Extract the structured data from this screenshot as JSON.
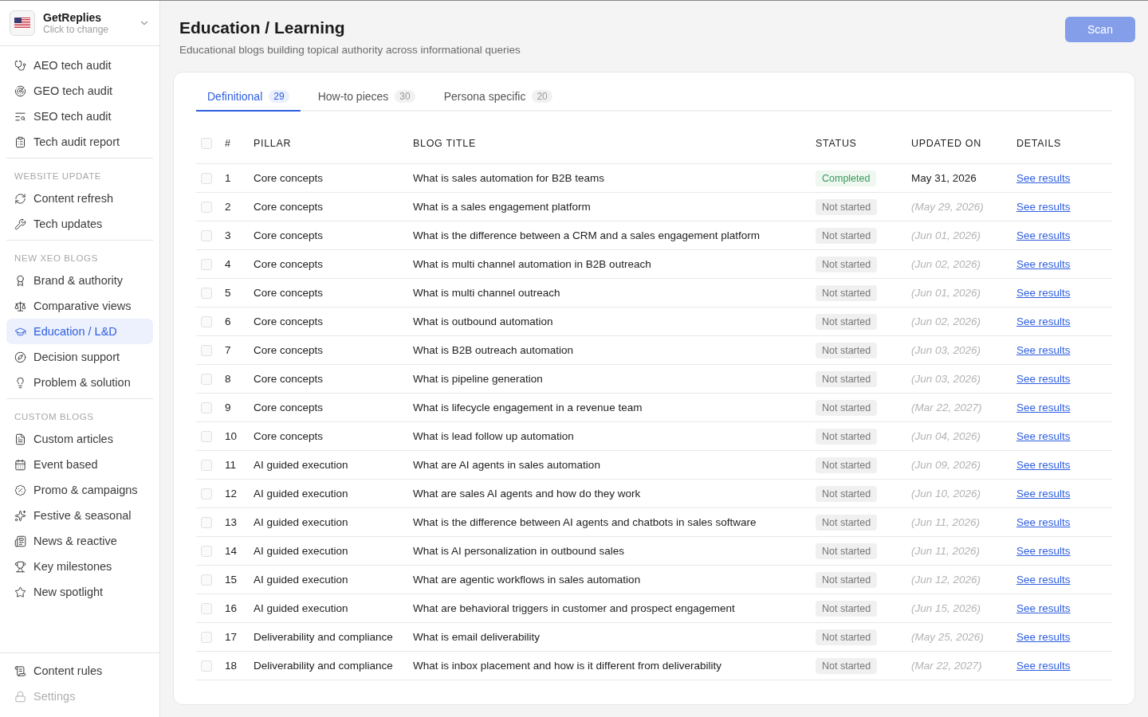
{
  "brand": {
    "name": "GetReplies",
    "hint": "Click to change"
  },
  "sidebar": {
    "sections": [
      {
        "items": [
          {
            "label": "AEO tech audit",
            "selected": false,
            "disabled": false
          },
          {
            "label": "GEO tech audit",
            "selected": false,
            "disabled": false
          },
          {
            "label": "SEO tech audit",
            "selected": false,
            "disabled": false
          },
          {
            "label": "Tech audit report",
            "selected": false,
            "disabled": false
          }
        ]
      },
      {
        "heading": "WEBSITE UPDATE",
        "items": [
          {
            "label": "Content refresh",
            "selected": false,
            "disabled": false
          },
          {
            "label": "Tech updates",
            "selected": false,
            "disabled": false
          }
        ]
      },
      {
        "heading": "NEW XEO BLOGS",
        "items": [
          {
            "label": "Brand & authority",
            "selected": false,
            "disabled": false
          },
          {
            "label": "Comparative views",
            "selected": false,
            "disabled": false
          },
          {
            "label": "Education / L&D",
            "selected": true,
            "disabled": false
          },
          {
            "label": "Decision support",
            "selected": false,
            "disabled": false
          },
          {
            "label": "Problem & solution",
            "selected": false,
            "disabled": false
          }
        ]
      },
      {
        "heading": "CUSTOM BLOGS",
        "items": [
          {
            "label": "Custom articles",
            "selected": false,
            "disabled": false
          },
          {
            "label": "Event based",
            "selected": false,
            "disabled": false
          },
          {
            "label": "Promo & campaigns",
            "selected": false,
            "disabled": false
          },
          {
            "label": "Festive & seasonal",
            "selected": false,
            "disabled": false
          },
          {
            "label": "News & reactive",
            "selected": false,
            "disabled": false
          },
          {
            "label": "Key milestones",
            "selected": false,
            "disabled": false
          },
          {
            "label": "New spotlight",
            "selected": false,
            "disabled": false
          }
        ]
      },
      {
        "items": [
          {
            "label": "Content rules",
            "selected": false,
            "disabled": false
          },
          {
            "label": "Settings",
            "selected": false,
            "disabled": true
          }
        ]
      }
    ]
  },
  "page": {
    "title": "Education / Learning",
    "subtitle": "Educational blogs building topical authority across informational queries",
    "scan_button": {
      "label": "Scan",
      "disabled": true
    }
  },
  "tabs": [
    {
      "label": "Definitional",
      "count": "29",
      "selected": true
    },
    {
      "label": "How-to pieces",
      "count": "30",
      "selected": false
    },
    {
      "label": "Persona specific",
      "count": "20",
      "selected": false
    }
  ],
  "table": {
    "header_checked": false,
    "columns": [
      "#",
      "PILLAR",
      "BLOG TITLE",
      "STATUS",
      "UPDATED ON",
      "DETAILS"
    ],
    "rows": [
      {
        "checked": false,
        "number": "1",
        "pillar": "Core concepts",
        "title": "What is sales automation for B2B teams",
        "status": {
          "label": "Completed",
          "kind": "completed"
        },
        "updated": {
          "text": "May 31, 2026",
          "estimated": false
        },
        "details": "See results"
      },
      {
        "checked": false,
        "number": "2",
        "pillar": "Core concepts",
        "title": "What is a sales engagement platform",
        "status": {
          "label": "Not started",
          "kind": "not_started"
        },
        "updated": {
          "text": "(May 29, 2026)",
          "estimated": true
        },
        "details": "See results"
      },
      {
        "checked": false,
        "number": "3",
        "pillar": "Core concepts",
        "title": "What is the difference between a CRM and a sales engagement platform",
        "status": {
          "label": "Not started",
          "kind": "not_started"
        },
        "updated": {
          "text": "(Jun 01, 2026)",
          "estimated": true
        },
        "details": "See results"
      },
      {
        "checked": false,
        "number": "4",
        "pillar": "Core concepts",
        "title": "What is multi channel automation in B2B outreach",
        "status": {
          "label": "Not started",
          "kind": "not_started"
        },
        "updated": {
          "text": "(Jun 02, 2026)",
          "estimated": true
        },
        "details": "See results"
      },
      {
        "checked": false,
        "number": "5",
        "pillar": "Core concepts",
        "title": "What is multi channel outreach",
        "status": {
          "label": "Not started",
          "kind": "not_started"
        },
        "updated": {
          "text": "(Jun 01, 2026)",
          "estimated": true
        },
        "details": "See results"
      },
      {
        "checked": false,
        "number": "6",
        "pillar": "Core concepts",
        "title": "What is outbound automation",
        "status": {
          "label": "Not started",
          "kind": "not_started"
        },
        "updated": {
          "text": "(Jun 02, 2026)",
          "estimated": true
        },
        "details": "See results"
      },
      {
        "checked": false,
        "number": "7",
        "pillar": "Core concepts",
        "title": "What is B2B outreach automation",
        "status": {
          "label": "Not started",
          "kind": "not_started"
        },
        "updated": {
          "text": "(Jun 03, 2026)",
          "estimated": true
        },
        "details": "See results"
      },
      {
        "checked": false,
        "number": "8",
        "pillar": "Core concepts",
        "title": "What is pipeline generation",
        "status": {
          "label": "Not started",
          "kind": "not_started"
        },
        "updated": {
          "text": "(Jun 03, 2026)",
          "estimated": true
        },
        "details": "See results"
      },
      {
        "checked": false,
        "number": "9",
        "pillar": "Core concepts",
        "title": "What is lifecycle engagement in a revenue team",
        "status": {
          "label": "Not started",
          "kind": "not_started"
        },
        "updated": {
          "text": "(Mar 22, 2027)",
          "estimated": true
        },
        "details": "See results"
      },
      {
        "checked": false,
        "number": "10",
        "pillar": "Core concepts",
        "title": "What is lead follow up automation",
        "status": {
          "label": "Not started",
          "kind": "not_started"
        },
        "updated": {
          "text": "(Jun 04, 2026)",
          "estimated": true
        },
        "details": "See results"
      },
      {
        "checked": false,
        "number": "11",
        "pillar": "AI guided execution",
        "title": "What are AI agents in sales automation",
        "status": {
          "label": "Not started",
          "kind": "not_started"
        },
        "updated": {
          "text": "(Jun 09, 2026)",
          "estimated": true
        },
        "details": "See results"
      },
      {
        "checked": false,
        "number": "12",
        "pillar": "AI guided execution",
        "title": "What are sales AI agents and how do they work",
        "status": {
          "label": "Not started",
          "kind": "not_started"
        },
        "updated": {
          "text": "(Jun 10, 2026)",
          "estimated": true
        },
        "details": "See results"
      },
      {
        "checked": false,
        "number": "13",
        "pillar": "AI guided execution",
        "title": "What is the difference between AI agents and chatbots in sales software",
        "status": {
          "label": "Not started",
          "kind": "not_started"
        },
        "updated": {
          "text": "(Jun 11, 2026)",
          "estimated": true
        },
        "details": "See results"
      },
      {
        "checked": false,
        "number": "14",
        "pillar": "AI guided execution",
        "title": "What is AI personalization in outbound sales",
        "status": {
          "label": "Not started",
          "kind": "not_started"
        },
        "updated": {
          "text": "(Jun 11, 2026)",
          "estimated": true
        },
        "details": "See results"
      },
      {
        "checked": false,
        "number": "15",
        "pillar": "AI guided execution",
        "title": "What are agentic workflows in sales automation",
        "status": {
          "label": "Not started",
          "kind": "not_started"
        },
        "updated": {
          "text": "(Jun 12, 2026)",
          "estimated": true
        },
        "details": "See results"
      },
      {
        "checked": false,
        "number": "16",
        "pillar": "AI guided execution",
        "title": "What are behavioral triggers in customer and prospect engagement",
        "status": {
          "label": "Not started",
          "kind": "not_started"
        },
        "updated": {
          "text": "(Jun 15, 2026)",
          "estimated": true
        },
        "details": "See results"
      },
      {
        "checked": false,
        "number": "17",
        "pillar": "Deliverability and compliance",
        "title": "What is email deliverability",
        "status": {
          "label": "Not started",
          "kind": "not_started"
        },
        "updated": {
          "text": "(May 25, 2026)",
          "estimated": true
        },
        "details": "See results"
      },
      {
        "checked": false,
        "number": "18",
        "pillar": "Deliverability and compliance",
        "title": "What is inbox placement and how is it different from deliverability",
        "status": {
          "label": "Not started",
          "kind": "not_started"
        },
        "updated": {
          "text": "(Mar 22, 2027)",
          "estimated": true
        },
        "details": "See results"
      }
    ]
  }
}
